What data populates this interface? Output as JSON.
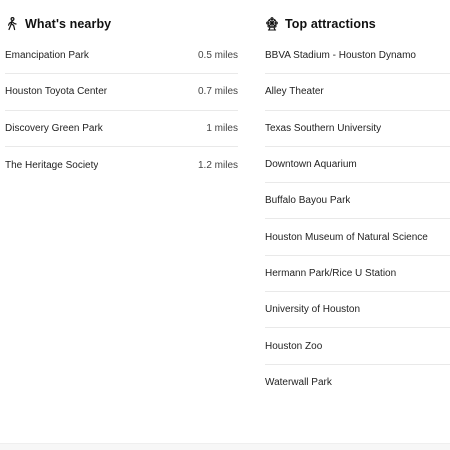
{
  "nearby": {
    "title": "What's nearby",
    "icon": "walking-person-icon",
    "items": [
      {
        "name": "Emancipation Park",
        "distance": "0.5 miles"
      },
      {
        "name": "Houston Toyota Center",
        "distance": "0.7 miles"
      },
      {
        "name": "Discovery Green Park",
        "distance": "1 miles"
      },
      {
        "name": "The Heritage Society",
        "distance": "1.2 miles"
      }
    ]
  },
  "attractions": {
    "title": "Top attractions",
    "icon": "ferris-wheel-icon",
    "items": [
      {
        "name": "BBVA Stadium - Houston Dynamo"
      },
      {
        "name": "Alley Theater"
      },
      {
        "name": "Texas Southern University"
      },
      {
        "name": "Downtown Aquarium"
      },
      {
        "name": "Buffalo Bayou Park"
      },
      {
        "name": "Houston Museum of Natural Science"
      },
      {
        "name": "Hermann Park/Rice U Station"
      },
      {
        "name": "University of Houston"
      },
      {
        "name": "Houston Zoo"
      },
      {
        "name": "Waterwall Park"
      }
    ]
  }
}
